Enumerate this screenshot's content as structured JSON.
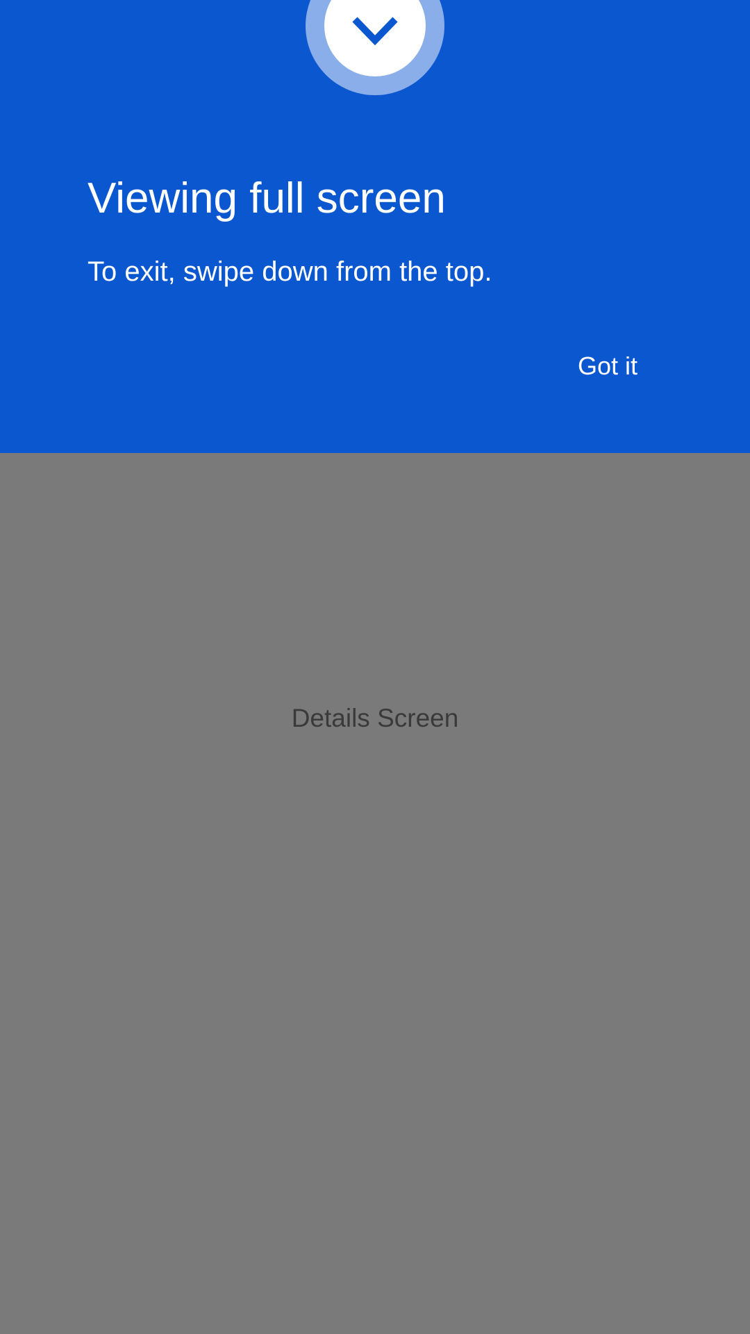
{
  "colors": {
    "panel_background": "#0b57d0",
    "ring": "#8aaee9",
    "screen_dim": "#7a7a7a",
    "details_text": "#3a3a3a"
  },
  "panel": {
    "icon": "chevron-down-icon",
    "title": "Viewing full screen",
    "message": "To exit, swipe down from the top.",
    "confirm_label": "Got it"
  },
  "main": {
    "label": "Details Screen"
  }
}
